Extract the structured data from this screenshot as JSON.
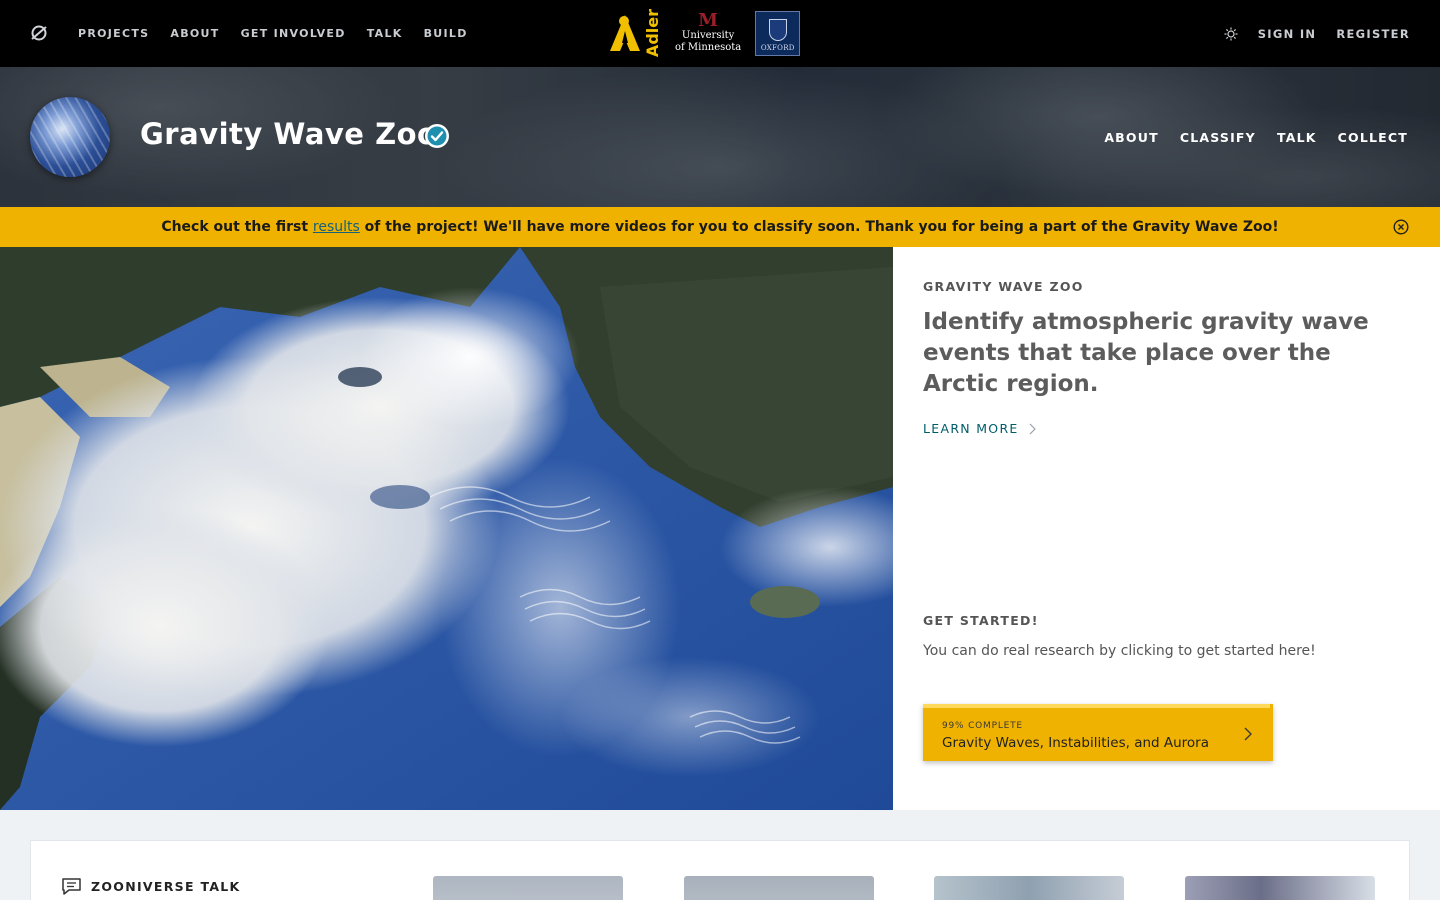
{
  "topnav": {
    "links": [
      "PROJECTS",
      "ABOUT",
      "GET INVOLVED",
      "TALK",
      "BUILD"
    ],
    "partners": {
      "adler": "Adler",
      "umn_line1": "University",
      "umn_line2": "of Minnesota",
      "oxford": "OXFORD"
    },
    "sign_in": "SIGN IN",
    "register": "REGISTER",
    "theme_icon": "sun-icon",
    "logo_icon": "zooniverse-logo-icon"
  },
  "project": {
    "title": "Gravity Wave Zoo",
    "nav": [
      "ABOUT",
      "CLASSIFY",
      "TALK",
      "COLLECT"
    ],
    "verified_icon": "verified-check-icon"
  },
  "announcement": {
    "before": "Check out the first ",
    "link": "results",
    "after": " of the project! We'll have more videos for you to classify soon. Thank you for being a part of the Gravity Wave Zoo!",
    "close_icon": "close-circle-icon"
  },
  "intro": {
    "kicker": "GRAVITY WAVE ZOO",
    "description": "Identify atmospheric gravity wave events that take place over the Arctic region.",
    "learn_more": "LEARN MORE",
    "get_started_heading": "GET STARTED!",
    "get_started_text": "You can do real research by clicking to get started here!"
  },
  "workflow": {
    "progress_label": "99% COMPLETE",
    "progress": 0.99,
    "name": "Gravity Waves, Instabilities, and Aurora"
  },
  "talk": {
    "title": "ZOONIVERSE TALK"
  },
  "colors": {
    "accent_yellow": "#f0b200",
    "link_teal": "#005d69",
    "nav_bg": "#000000"
  }
}
